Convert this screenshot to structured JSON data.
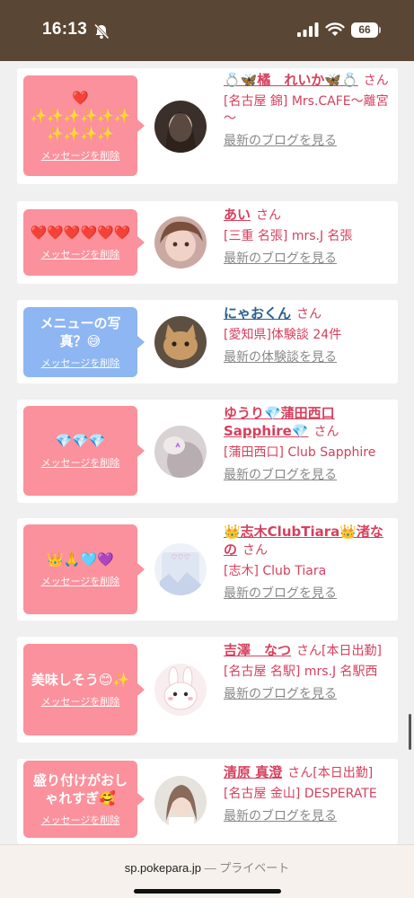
{
  "status_bar": {
    "time": "16:13",
    "battery": "66",
    "icons": [
      "bell-slash-icon",
      "signal-icon",
      "wifi-icon",
      "battery-icon"
    ]
  },
  "colors": {
    "header_brown": "#5a4634",
    "bubble_pink": "#fb919c",
    "bubble_blue": "#8db6f2",
    "name_pink": "#d6405e",
    "name_blue": "#2a5f8e",
    "link_gray": "#888888"
  },
  "items": [
    {
      "message": "❤️\n✨✨✨✨✨✨\n✨✨✨✨",
      "delete": "メッセージを削除",
      "name": "💍🦋橘　れいか🦋💍",
      "san": "さん",
      "shop": "[名古屋 錦] Mrs.CAFE～離宮～",
      "link": "最新のブログを見る",
      "bubble_color": "pink",
      "avatar": "avatar-photo-1"
    },
    {
      "message": "❤️❤️❤️❤️❤️❤️",
      "delete": "メッセージを削除",
      "name": "あい",
      "san": "さん",
      "shop": "[三重 名張] mrs.J 名張",
      "link": "最新のブログを見る",
      "bubble_color": "pink",
      "avatar": "avatar-photo-2"
    },
    {
      "message": "メニューの写真？😅",
      "delete": "メッセージを削除",
      "name": "にゃおくん",
      "san": "さん",
      "shop": "[愛知県]体験談 24件",
      "link": "最新の体験談を見る",
      "bubble_color": "blue",
      "avatar": "avatar-cat"
    },
    {
      "message": "💎💎💎",
      "delete": "メッセージを削除",
      "name": "ゆうり💎蒲田西口Sapphire💎",
      "san": "さん",
      "shop": "[蒲田西口] Club Sapphire",
      "link": "最新のブログを見る",
      "bubble_color": "pink",
      "avatar": "avatar-photo-4"
    },
    {
      "message": "👑🙏🩵💜",
      "delete": "メッセージを削除",
      "name": "👑志木ClubTiara👑渚なの",
      "san": "さん",
      "shop": "[志木] Club Tiara",
      "link": "最新のブログを見る",
      "bubble_color": "pink",
      "avatar": "avatar-photo-5"
    },
    {
      "message": "美味しそう😊✨",
      "delete": "メッセージを削除",
      "name": "吉澤　なつ",
      "san": "さん[本日出勤]",
      "shop": "[名古屋 名駅] mrs.J 名駅西",
      "link": "最新のブログを見る",
      "bubble_color": "pink",
      "avatar": "avatar-bunny"
    },
    {
      "message": "盛り付けがおしゃれすぎ🥰",
      "delete": "メッセージを削除",
      "name": "清原 真澄",
      "san": "さん[本日出勤]",
      "shop": "[名古屋 金山] DESPERATE",
      "link": "最新のブログを見る",
      "bubble_color": "pink",
      "avatar": "avatar-photo-7"
    }
  ],
  "browser": {
    "domain": "sp.pokepara.jp",
    "separator": "—",
    "mode": "プライベート"
  }
}
